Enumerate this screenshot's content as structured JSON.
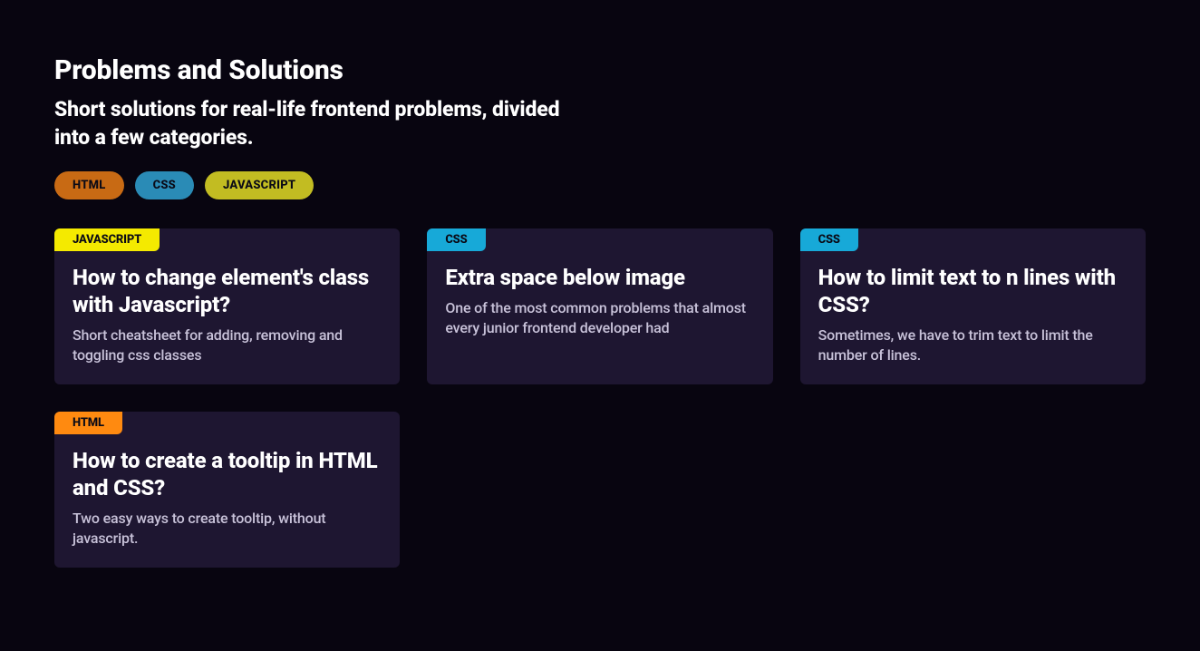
{
  "header": {
    "title": "Problems and Solutions",
    "subtitle": "Short solutions for real-life frontend problems, divided into a few categories."
  },
  "filters": [
    {
      "label": "HTML",
      "bg": "#c86a14"
    },
    {
      "label": "CSS",
      "bg": "#2a8bb6"
    },
    {
      "label": "JAVASCRIPT",
      "bg": "#c2bc22"
    }
  ],
  "tagColors": {
    "HTML": "#ff8a10",
    "CSS": "#17a9d8",
    "JAVASCRIPT": "#f4ea00"
  },
  "cards": [
    {
      "tag": "JAVASCRIPT",
      "title": "How to change element's class with Javascript?",
      "desc": "Short cheatsheet for adding, removing and toggling css classes"
    },
    {
      "tag": "CSS",
      "title": "Extra space below image",
      "desc": "One of the most common problems that almost every junior frontend developer had"
    },
    {
      "tag": "CSS",
      "title": "How to limit text to n lines with CSS?",
      "desc": "Sometimes, we have to trim text to limit the number of lines."
    },
    {
      "tag": "HTML",
      "title": "How to create a tooltip in HTML and CSS?",
      "desc": "Two easy ways to create tooltip, without javascript."
    }
  ]
}
